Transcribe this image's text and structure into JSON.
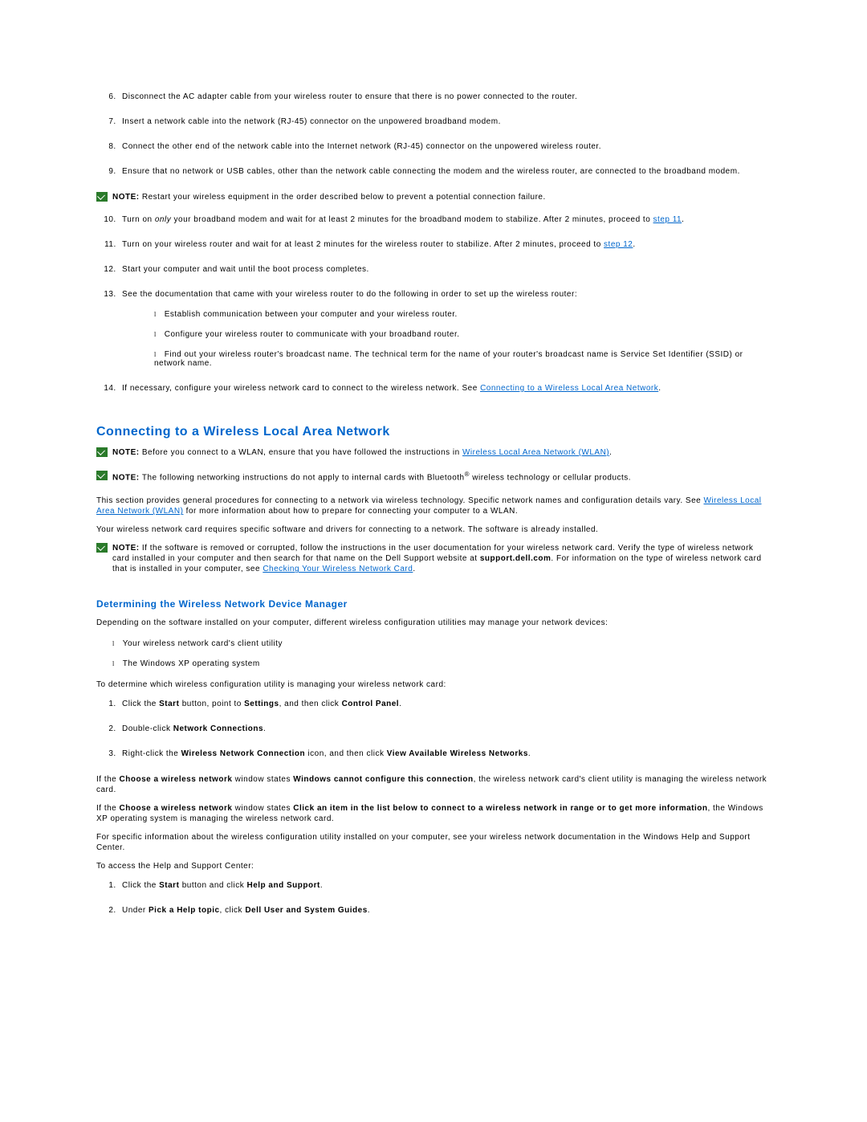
{
  "steps_a": {
    "s6": "Disconnect the AC adapter cable from your wireless router to ensure that there is no power connected to the router.",
    "s7": "Insert a network cable into the network (RJ-45) connector on the unpowered broadband modem.",
    "s8": "Connect the other end of the network cable into the Internet network (RJ-45) connector on the unpowered wireless router.",
    "s9": "Ensure that no network or USB cables, other than the network cable connecting the modem and the wireless router, are connected to the broadband modem."
  },
  "note1": {
    "label": "NOTE: ",
    "text": "Restart your wireless equipment in the order described below to prevent a potential connection failure."
  },
  "steps_b": {
    "s10_a": "Turn on ",
    "s10_i": "only",
    "s10_b": " your broadband modem and wait for at least 2 minutes for the broadband modem to stabilize. After 2 minutes, proceed to ",
    "s10_link": "step 11",
    "s10_c": ".",
    "s11_a": "Turn on your wireless router and wait for at least 2 minutes for the wireless router to stabilize. After 2 minutes, proceed to ",
    "s11_link": "step 12",
    "s11_b": ".",
    "s12": "Start your computer and wait until the boot process completes.",
    "s13": "See the documentation that came with your wireless router to do the following in order to set up the wireless router:",
    "s13_sub": {
      "a": "Establish communication between your computer and your wireless router.",
      "b": "Configure your wireless router to communicate with your broadband router.",
      "c": "Find out your wireless router's broadcast name. The technical term for the name of your router's broadcast name is Service Set Identifier (SSID) or network name."
    },
    "s14_a": "If necessary, configure your wireless network card to connect to the wireless network. See ",
    "s14_link": "Connecting to a Wireless Local Area Network",
    "s14_b": "."
  },
  "section_h2": "Connecting to a Wireless Local Area Network",
  "note2": {
    "label": "NOTE: ",
    "text_a": "Before you connect to a WLAN, ensure that you have followed the instructions in ",
    "link": "Wireless Local Area Network (WLAN)",
    "text_b": "."
  },
  "note3": {
    "label": "NOTE: ",
    "text_a": "The following networking instructions do not apply to internal cards with Bluetooth",
    "reg": "®",
    "text_b": " wireless technology or cellular products."
  },
  "para1_a": "This section provides general procedures for connecting to a network via wireless technology. Specific network names and configuration details vary. See ",
  "para1_link": "Wireless Local Area Network (WLAN)",
  "para1_b": " for more information about how to prepare for connecting your computer to a WLAN.",
  "para2": "Your wireless network card requires specific software and drivers for connecting to a network. The software is already installed.",
  "note4": {
    "label": "NOTE: ",
    "text_a": "If the software is removed or corrupted, follow the instructions in the user documentation for your wireless network card. Verify the type of wireless network card installed in your computer and then search for that name on the Dell Support website at ",
    "bold": "support.dell.com",
    "text_b": ". For information on the type of wireless network card that is installed in your computer, see ",
    "link": "Checking Your Wireless Network Card",
    "text_c": "."
  },
  "sub_h3": "Determining the Wireless Network Device Manager",
  "para3": "Depending on the software installed on your computer, different wireless configuration utilities may manage your network devices:",
  "bullets1": {
    "a": "Your wireless network card's client utility",
    "b": "The Windows XP operating system"
  },
  "para4": "To determine which wireless configuration utility is managing your wireless network card:",
  "steps_c": {
    "s1_a": "Click the ",
    "s1_b1": "Start",
    "s1_b": " button, point to ",
    "s1_b2": "Settings",
    "s1_c": ", and then click ",
    "s1_b3": "Control Panel",
    "s1_d": ".",
    "s2_a": "Double-click ",
    "s2_b1": "Network Connections",
    "s2_b": ".",
    "s3_a": "Right-click the ",
    "s3_b1": "Wireless Network Connection",
    "s3_b": " icon, and then click ",
    "s3_b2": "View Available Wireless Networks",
    "s3_c": "."
  },
  "para5_a": "If the ",
  "para5_b1": "Choose a wireless network",
  "para5_b": " window states ",
  "para5_b2": "Windows cannot configure this connection",
  "para5_c": ", the wireless network card's client utility is managing the wireless network card.",
  "para6_a": "If the ",
  "para6_b1": "Choose a wireless network",
  "para6_b": " window states ",
  "para6_b2": "Click an item in the list below to connect to a wireless network in range or to get more information",
  "para6_c": ", the Windows XP operating system is managing the wireless network card.",
  "para7": "For specific information about the wireless configuration utility installed on your computer, see your wireless network documentation in the Windows Help and Support Center.",
  "para8": "To access the Help and Support Center:",
  "steps_d": {
    "s1_a": "Click the ",
    "s1_b1": "Start",
    "s1_b": " button and click ",
    "s1_b2": "Help and Support",
    "s1_c": ".",
    "s2_a": "Under ",
    "s2_b1": "Pick a Help topic",
    "s2_b": ", click ",
    "s2_b2": "Dell User and System Guides",
    "s2_c": "."
  }
}
